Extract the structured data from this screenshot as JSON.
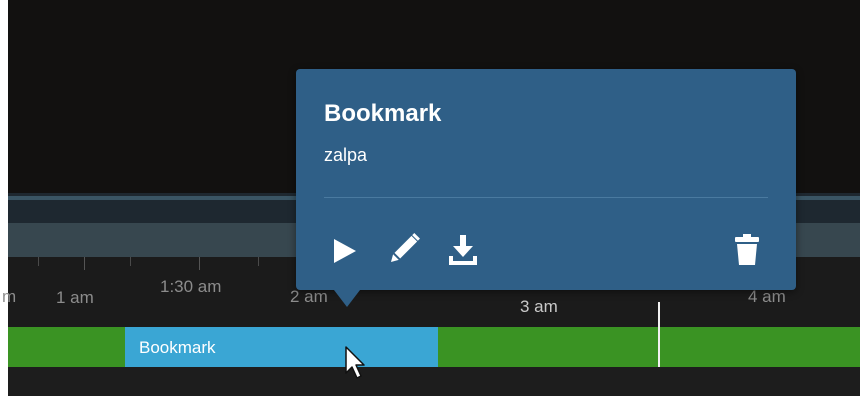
{
  "timeline": {
    "ticks": [
      "1 am",
      "1:30 am",
      "2 am",
      "3 am",
      "4 am"
    ],
    "track_bookmark_label": "Bookmark"
  },
  "popup": {
    "title": "Bookmark",
    "description": "zalpa",
    "actions": {
      "play": "play-icon",
      "edit": "pencil-icon",
      "download": "download-icon",
      "delete": "trash-icon"
    }
  },
  "colors": {
    "popup_bg": "#2f5f87",
    "track_green": "#3a9323",
    "bookmark_blue": "#3aa6d4"
  }
}
